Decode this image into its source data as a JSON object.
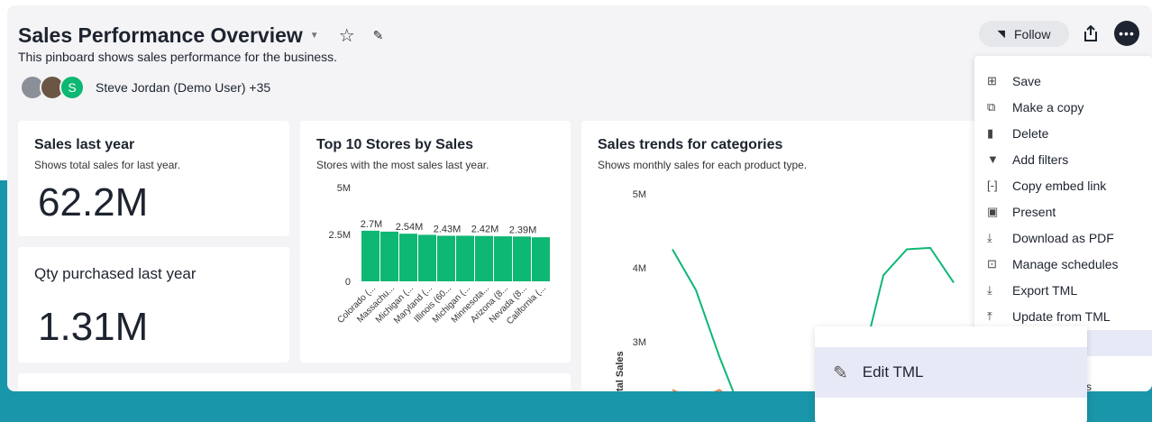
{
  "header": {
    "title": "Sales Performance Overview",
    "description": "This pinboard shows sales performance for the business.",
    "authors_text": "Steve Jordan (Demo User) +35",
    "avatar_initial": "S",
    "follow_label": "Follow"
  },
  "menu": {
    "items": [
      {
        "label": "Save",
        "icon": "plus-box-icon"
      },
      {
        "label": "Make a copy",
        "icon": "copy-icon"
      },
      {
        "label": "Delete",
        "icon": "trash-icon"
      },
      {
        "label": "Add filters",
        "icon": "filter-icon"
      },
      {
        "label": "Copy embed link",
        "icon": "embed-icon"
      },
      {
        "label": "Present",
        "icon": "present-icon"
      },
      {
        "label": "Download as PDF",
        "icon": "download-icon"
      },
      {
        "label": "Manage schedules",
        "icon": "schedule-icon"
      },
      {
        "label": "Export TML",
        "icon": "export-icon"
      },
      {
        "label": "Update from TML",
        "icon": "update-icon"
      }
    ]
  },
  "tooltip": {
    "label": "Edit TML",
    "icon": "pencil-icon",
    "peek_text": "s"
  },
  "cards": {
    "sales_last_year": {
      "title": "Sales last year",
      "desc": "Shows total sales for last year.",
      "value": "62.2M"
    },
    "qty_last_year": {
      "title": "Qty purchased last year",
      "value": "1.31M"
    },
    "top_stores": {
      "title": "Top 10 Stores by Sales",
      "desc": "Stores with the most sales last year."
    },
    "trends": {
      "title": "Sales trends for categories",
      "desc": "Shows monthly sales for each product type."
    }
  },
  "colors": {
    "accent": "#0db774",
    "teal": "#1996a9",
    "orange": "#f0844b"
  },
  "chart_data": [
    {
      "type": "bar",
      "title": "Top 10 Stores by Sales",
      "categories": [
        "Colorado (...",
        "Massachu...",
        "Michigan (...",
        "Maryland (...",
        "Illinois (60...",
        "Michigan (...",
        "Minnesota...",
        "Arizona (8...",
        "Nevada (8...",
        "California (..."
      ],
      "values": [
        2.7,
        2.65,
        2.54,
        2.48,
        2.43,
        2.43,
        2.42,
        2.4,
        2.39,
        2.35
      ],
      "value_labels": [
        "2.7M",
        "",
        "2.54M",
        "",
        "2.43M",
        "",
        "2.42M",
        "",
        "2.39M",
        ""
      ],
      "yticks": [
        "0",
        "2.5M",
        "5M"
      ],
      "ylim": [
        0,
        5
      ],
      "color": "#0db774"
    },
    {
      "type": "line",
      "title": "Sales trends for categories",
      "ylabel": "tal Sales",
      "yticks": [
        "3M",
        "4M",
        "5M"
      ],
      "ylim": [
        2.3,
        5
      ],
      "series": [
        {
          "color": "#0db774",
          "points": [
            [
              0,
              4.25
            ],
            [
              1,
              3.7
            ],
            [
              2,
              2.8
            ],
            [
              3,
              2.0
            ],
            [
              8,
              2.6
            ],
            [
              9,
              3.9
            ],
            [
              10,
              4.25
            ],
            [
              11,
              4.27
            ],
            [
              12,
              3.8
            ]
          ]
        },
        {
          "color": "#f0844b",
          "points": [
            [
              0,
              2.35
            ],
            [
              1,
              2.2
            ],
            [
              2,
              2.35
            ],
            [
              3,
              2.1
            ]
          ]
        }
      ]
    }
  ]
}
